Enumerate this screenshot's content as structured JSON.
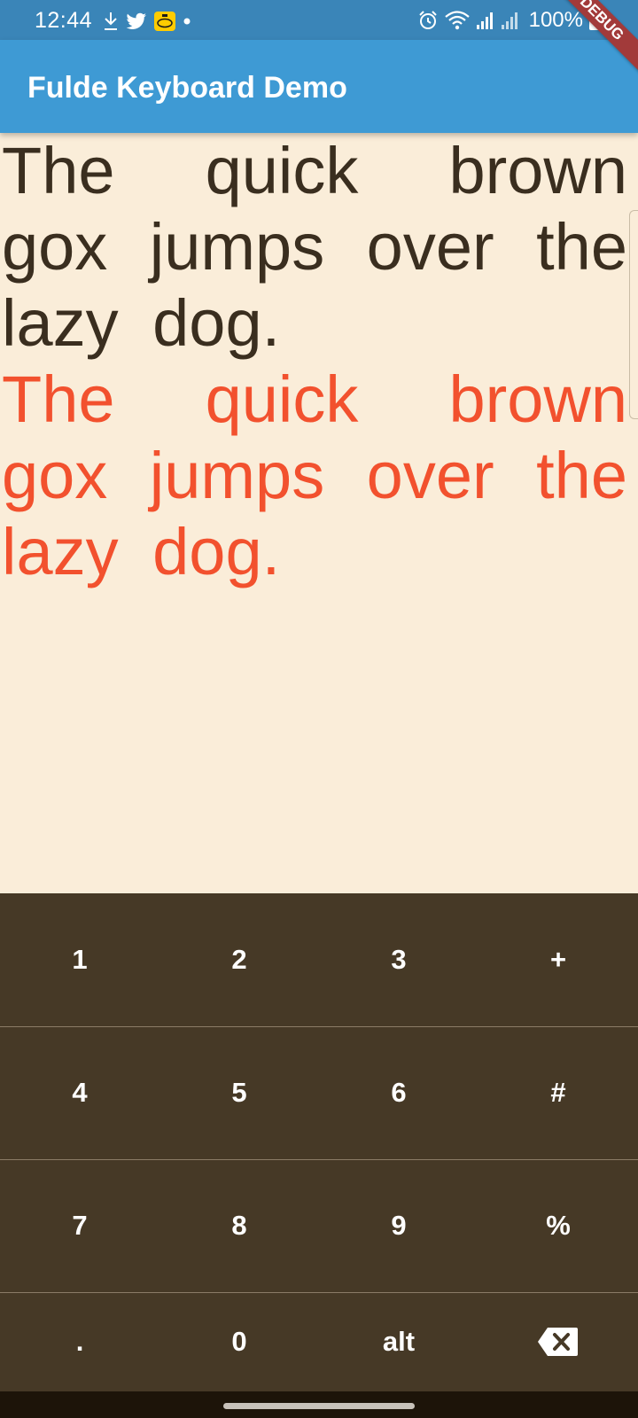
{
  "status_bar": {
    "time": "12:44",
    "left_icons": [
      "download-icon",
      "twitter-icon",
      "mtn-icon",
      "dot-icon"
    ],
    "right_icons": [
      "alarm-icon",
      "wifi-icon",
      "signal-icon",
      "signal-icon",
      "battery-icon"
    ],
    "battery": "100%"
  },
  "app_bar": {
    "title": "Fulde Keyboard Demo"
  },
  "debug_banner": "DEBUG",
  "content": {
    "text_1": "The quick brown gox jumps over the lazy dog.",
    "text_2": "The quick brown gox jumps over the lazy dog.",
    "text_1_color": "#3A2E1F",
    "text_2_color": "#F2512E"
  },
  "keyboard": {
    "rows": [
      [
        "1",
        "2",
        "3",
        "+"
      ],
      [
        "4",
        "5",
        "6",
        "#"
      ],
      [
        "7",
        "8",
        "9",
        "%"
      ],
      [
        ".",
        "0",
        "alt",
        "backspace-icon"
      ]
    ],
    "background": "#463926"
  },
  "colors": {
    "app_bar": "#3E9AD4",
    "status_bar": "#3A85B8",
    "page_background": "#FAEDD9"
  }
}
